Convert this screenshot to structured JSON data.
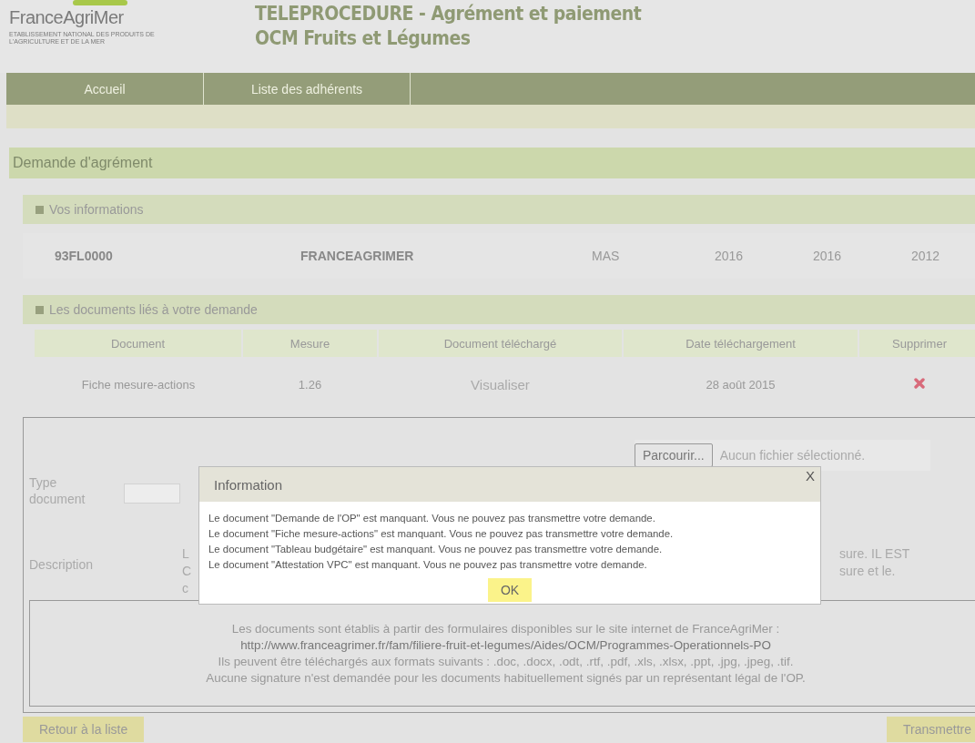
{
  "header": {
    "logo": "FranceAgriMer",
    "logo_subtitle": "ETABLISSEMENT NATIONAL DES PRODUITS DE L'AGRICULTURE ET DE LA MER",
    "title_lines": [
      "TELEPROCEDURE - Agrément et paiement",
      "OCM Fruits et Légumes"
    ]
  },
  "nav": [
    {
      "label": "Accueil"
    },
    {
      "label": "Liste des adhérents"
    }
  ],
  "section_title": "Demande d'agrément",
  "info_panel": {
    "title": "Vos informations",
    "values": [
      "93FL0000",
      "FRANCEAGRIMER",
      "MAS",
      "2016",
      "2016",
      "2012"
    ]
  },
  "documents_panel": {
    "title": "Les documents liés à votre demande",
    "columns": [
      "Document",
      "Mesure",
      "Document téléchargé",
      "Date téléchargement",
      "Supprimer"
    ],
    "rows": [
      {
        "document": "Fiche mesure-actions",
        "mesure": "1.26",
        "link": "Visualiser",
        "date": "28 août 2015"
      }
    ]
  },
  "form": {
    "type_label": "Type document",
    "browse_button": "Parcourir...",
    "file_status": "Aucun fichier sélectionné.",
    "description_label": "Description",
    "description_left": [
      "L",
      "C",
      "c"
    ],
    "description_right": [
      "sure. IL EST",
      "sure et le."
    ]
  },
  "notice": [
    "Les documents sont établis à partir des formulaires disponibles sur le site internet de FranceAgriMer :",
    "http://www.franceagrimer.fr/fam/filiere-fruit-et-legumes/Aides/OCM/Programmes-Operationnels-PO",
    "Ils peuvent être téléchargés aux formats suivants : .doc, .docx, .odt, .rtf, .pdf, .xls, .xlsx, .ppt, .jpg, .jpeg, .tif.",
    "Aucune signature n'est demandée pour les documents habituellement signés par un représentant légal de l'OP."
  ],
  "buttons": {
    "back": "Retour à la liste",
    "submit": "Transmettre"
  },
  "dialog": {
    "title": "Information",
    "close": "X",
    "messages": [
      "Le document \"Demande de l'OP\" est manquant. Vous ne pouvez pas transmettre votre demande.",
      "Le document \"Fiche mesure-actions\" est manquant. Vous ne pouvez pas transmettre votre demande.",
      "Le document \"Tableau budgétaire\" est manquant. Vous ne pouvez pas transmettre votre demande.",
      "Le document \"Attestation VPC\" est manquant. Vous ne pouvez pas transmettre votre demande."
    ],
    "ok": "OK"
  }
}
